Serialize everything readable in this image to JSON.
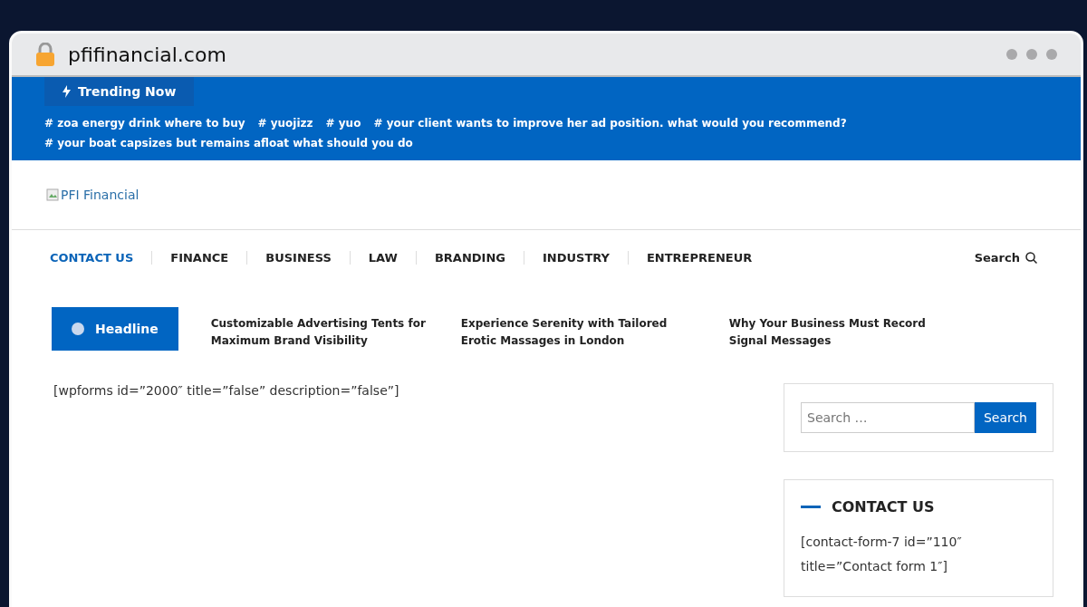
{
  "browser": {
    "url": "pfifinancial.com"
  },
  "trending": {
    "label": "Trending Now",
    "tags": [
      {
        "text": "# zoa energy drink where to buy"
      },
      {
        "text": "# yuojizz"
      },
      {
        "text": "# yuo"
      },
      {
        "text": "# your client wants to improve her ad position. what would you recommend?"
      },
      {
        "text": "# your boat capsizes but remains afloat what should you do"
      }
    ]
  },
  "logo": {
    "alt": "PFI Financial"
  },
  "nav": {
    "items": [
      {
        "label": "CONTACT US",
        "selected": true
      },
      {
        "label": "FINANCE",
        "selected": false
      },
      {
        "label": "BUSINESS",
        "selected": false
      },
      {
        "label": "LAW",
        "selected": false
      },
      {
        "label": "BRANDING",
        "selected": false
      },
      {
        "label": "INDUSTRY",
        "selected": false
      },
      {
        "label": "ENTREPRENEUR",
        "selected": false
      }
    ],
    "search": "Search"
  },
  "headline": {
    "label": "Headline",
    "posts": [
      {
        "title": "Customizable Advertising Tents for Maximum Brand Visibility"
      },
      {
        "title": "Experience Serenity with Tailored Erotic Massages in London"
      },
      {
        "title": "Why Your Business Must Record Signal Messages"
      }
    ]
  },
  "main": {
    "text": "[wpforms id=”2000″ title=”false” description=”false”]"
  },
  "sidebar": {
    "search": {
      "placeholder": "Search …",
      "button": "Search"
    },
    "contact": {
      "title": "CONTACT US",
      "text": "[contact-form-7 id=”110″ title=”Contact form 1″]"
    }
  }
}
